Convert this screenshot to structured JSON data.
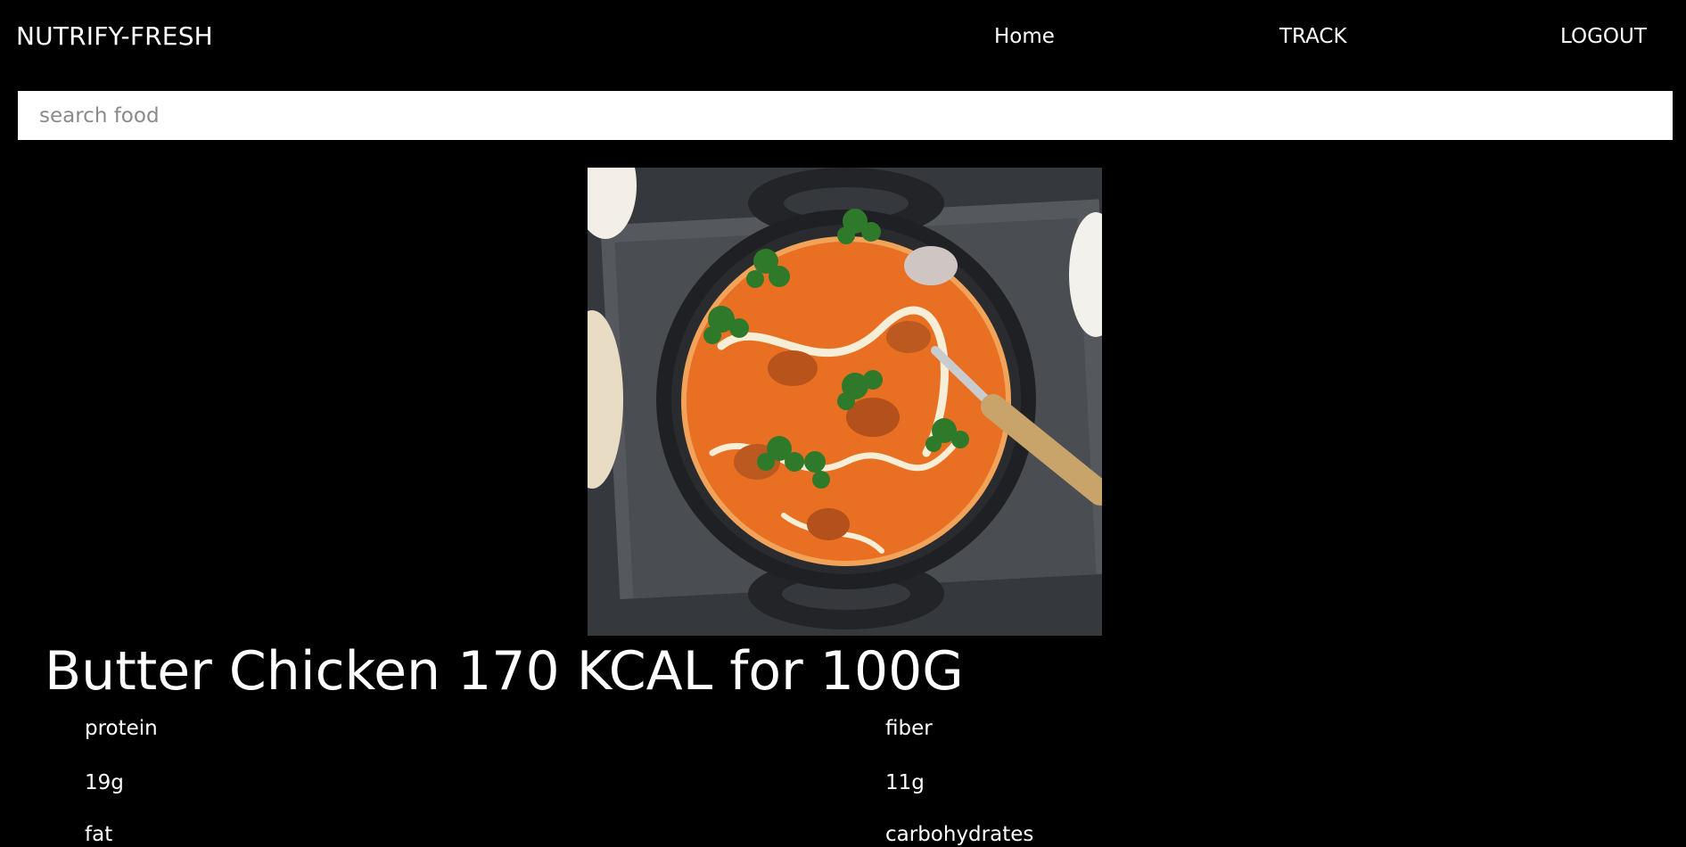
{
  "app": {
    "brand": "NUTRIFY-FRESH"
  },
  "nav": {
    "home": "Home",
    "track": "TRACK",
    "logout": "LOGOUT"
  },
  "search": {
    "placeholder": "search food",
    "value": ""
  },
  "food": {
    "title": "Butter Chicken 170 KCAL for 100G",
    "nutrients": {
      "protein": {
        "label": "protein",
        "value": "19g"
      },
      "fiber": {
        "label": "fiber",
        "value": "11g"
      },
      "fat": {
        "label": "fat"
      },
      "carbohydrates": {
        "label": "carbohydrates"
      }
    }
  }
}
